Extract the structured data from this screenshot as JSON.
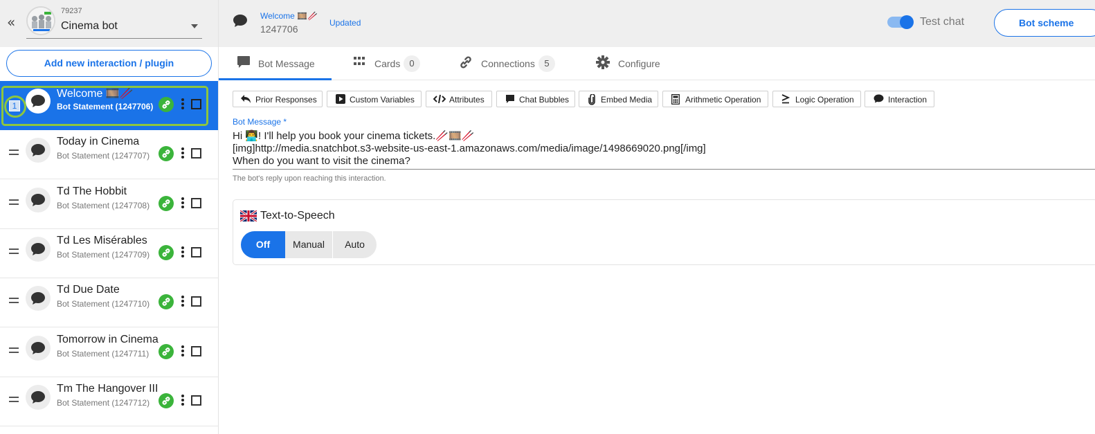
{
  "sidebar": {
    "collapse_glyph": "«",
    "bot_id": "79237",
    "bot_name": "Cinema bot",
    "add_button": "Add new interaction / plugin",
    "selected_number": "1",
    "items": [
      {
        "title": "Welcome 🎞️🥢",
        "sub": "Bot Statement (1247706)",
        "active": true
      },
      {
        "title": "Today in Cinema",
        "sub": "Bot Statement (1247707)",
        "active": false
      },
      {
        "title": "Td The Hobbit",
        "sub": "Bot Statement (1247708)",
        "active": false
      },
      {
        "title": "Td Les Misérables",
        "sub": "Bot Statement (1247709)",
        "active": false
      },
      {
        "title": "Td Due Date",
        "sub": "Bot Statement (1247710)",
        "active": false
      },
      {
        "title": "Tomorrow in Cinema",
        "sub": "Bot Statement (1247711)",
        "active": false
      },
      {
        "title": "Tm The Hangover III",
        "sub": "Bot Statement (1247712)",
        "active": false
      }
    ]
  },
  "topbar": {
    "title": "Welcome 🎞️🥢",
    "id": "1247706",
    "status": "Updated",
    "test_chat_label": "Test chat",
    "test_chat_on": true,
    "scheme_button": "Bot scheme"
  },
  "tabs": [
    {
      "label": "Bot Message",
      "icon": "chat-icon",
      "badge": null,
      "active": true
    },
    {
      "label": "Cards",
      "icon": "grid-icon",
      "badge": "0",
      "active": false
    },
    {
      "label": "Connections",
      "icon": "link-icon",
      "badge": "5",
      "active": false
    },
    {
      "label": "Configure",
      "icon": "gear-icon",
      "badge": null,
      "active": false
    }
  ],
  "toolbar": [
    {
      "label": "Prior Responses",
      "icon": "reply-icon"
    },
    {
      "label": "Custom Variables",
      "icon": "play-square-icon"
    },
    {
      "label": "Attributes",
      "icon": "code-icon"
    },
    {
      "label": "Chat Bubbles",
      "icon": "chat-bubble-icon"
    },
    {
      "label": "Embed Media",
      "icon": "paperclip-icon"
    },
    {
      "label": "Arithmetic Operation",
      "icon": "calculator-icon"
    },
    {
      "label": "Logic Operation",
      "icon": "greater-equal-icon"
    },
    {
      "label": "Interaction",
      "icon": "comment-icon"
    }
  ],
  "editor": {
    "label": "Bot Message *",
    "message": "Hi 👨‍💻! I'll help you book your cinema tickets.🥢🎞️🥢\n[img]http://media.snatchbot.s3-website-us-east-1.amazonaws.com/media/image/1498669020.png[/img]\nWhen do you want to visit the cinema?",
    "help": "The bot's reply upon reaching this interaction."
  },
  "tts": {
    "title": "Text-to-Speech",
    "options": [
      "Off",
      "Manual",
      "Auto"
    ],
    "selected": "Off"
  },
  "colors": {
    "accent": "#1a73e8",
    "link_green": "#3bb43b",
    "highlight": "#8dc63f"
  }
}
